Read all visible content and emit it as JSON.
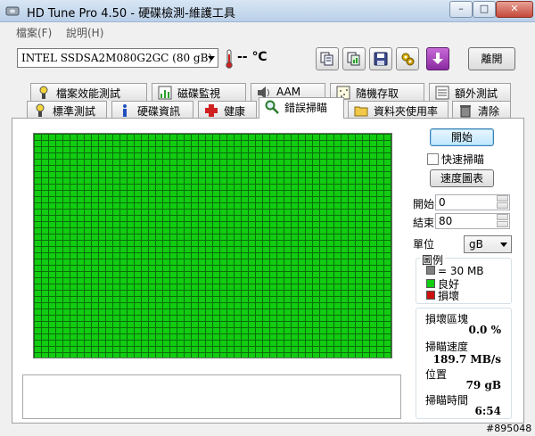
{
  "window": {
    "title": "HD Tune Pro 4.50 - 硬碟檢測-維護工具",
    "minimize": "–",
    "maximize": "□",
    "close": "✕"
  },
  "menu": [
    {
      "label": "檔案(F)"
    },
    {
      "label": "說明(H)"
    }
  ],
  "toolbar": {
    "drive": "INTEL SSDSA2M080G2GC (80 gB)",
    "temperature": "-- ℃",
    "exit_label": "離開",
    "icons": [
      "copy-info-icon",
      "copy-screenshot-icon",
      "save-icon",
      "options-icon",
      "download-icon"
    ]
  },
  "tabs_top": [
    {
      "label": "檔案效能測試",
      "icon": "file-benchmark-icon"
    },
    {
      "label": "磁碟監視",
      "icon": "disk-monitor-icon"
    },
    {
      "label": "AAM",
      "icon": "speaker-icon"
    },
    {
      "label": "隨機存取",
      "icon": "random-access-icon"
    },
    {
      "label": "額外測試",
      "icon": "extra-tests-icon"
    }
  ],
  "tabs_bottom": [
    {
      "label": "標準測試",
      "icon": "benchmark-icon"
    },
    {
      "label": "硬碟資訊",
      "icon": "info-icon"
    },
    {
      "label": "健康",
      "icon": "health-cross-icon"
    },
    {
      "label": "錯誤掃瞄",
      "icon": "magnifier-icon"
    },
    {
      "label": "資料夾使用率",
      "icon": "folder-icon"
    },
    {
      "label": "清除",
      "icon": "trash-icon"
    }
  ],
  "active_tab": "錯誤掃瞄",
  "scan": {
    "start_button": "開始",
    "quick_scan_label": "快速掃瞄",
    "quick_scan_checked": false,
    "speed_map_button": "速度圖表",
    "start_label": "開始",
    "start_value": "0",
    "end_label": "結束",
    "end_value": "80",
    "unit_label": "單位",
    "unit_value": "gB"
  },
  "legend": {
    "title": "圖例",
    "items": [
      {
        "label": "= 30 MB",
        "color": "#808080"
      },
      {
        "label": "良好",
        "color": "#12cc12"
      },
      {
        "label": "損壞",
        "color": "#cc1010"
      }
    ]
  },
  "stats": {
    "damaged_label": "損壞區塊",
    "damaged_value": "0.0 %",
    "speed_label": "掃瞄速度",
    "speed_value": "189.7 MB/s",
    "position_label": "位置",
    "position_value": "79 gB",
    "time_label": "掃瞄時間",
    "time_value": "6:54"
  },
  "watermark": "#895048",
  "colors": {
    "good": "#12cc12",
    "grid_line": "#0a6e0a",
    "accent": "#3c7fb1"
  }
}
